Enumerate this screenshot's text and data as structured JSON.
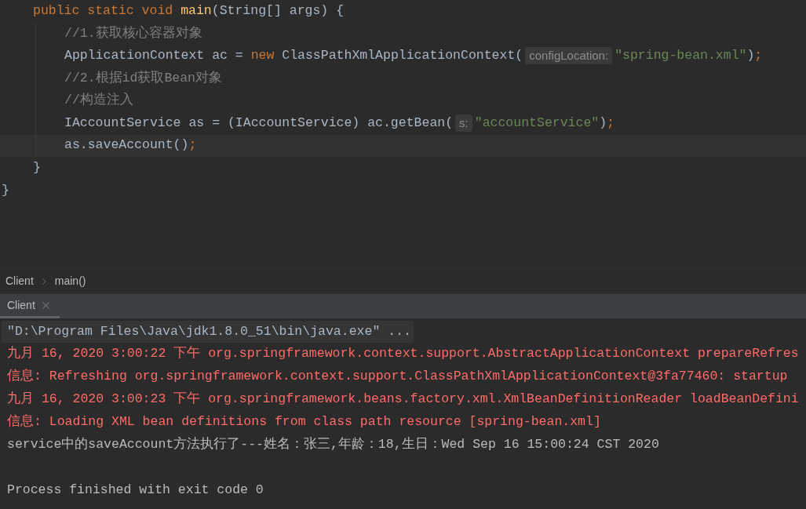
{
  "editor": {
    "class_members": [
      {
        "current": false,
        "tokens": [
          {
            "kind": "keyword",
            "text": "public static void "
          },
          {
            "kind": "method",
            "text": "main"
          },
          {
            "kind": "plain",
            "text": "(String[] args) {"
          }
        ],
        "children": [
          {
            "current": false,
            "tokens": [
              {
                "kind": "comment",
                "text": "//1.获取核心容器对象"
              }
            ]
          },
          {
            "current": false,
            "tokens": [
              {
                "kind": "plain",
                "text": "ApplicationContext ac = "
              },
              {
                "kind": "keyword",
                "text": "new"
              },
              {
                "kind": "plain",
                "text": " ClassPathXmlApplicationContext("
              },
              {
                "kind": "hint",
                "text": "configLocation:"
              },
              {
                "kind": "string",
                "text": "\"spring-bean.xml\""
              },
              {
                "kind": "plain",
                "text": ")"
              },
              {
                "kind": "keyword",
                "text": ";"
              }
            ]
          },
          {
            "current": false,
            "tokens": [
              {
                "kind": "comment",
                "text": "//2.根据id获取Bean对象"
              }
            ]
          },
          {
            "current": false,
            "tokens": [
              {
                "kind": "comment",
                "text": "//构造注入"
              }
            ]
          },
          {
            "current": false,
            "tokens": [
              {
                "kind": "plain",
                "text": "IAccountService as = (IAccountService) ac.getBean("
              },
              {
                "kind": "hint",
                "text": "s:"
              },
              {
                "kind": "string",
                "text": "\"accountService\""
              },
              {
                "kind": "plain",
                "text": ")"
              },
              {
                "kind": "keyword",
                "text": ";"
              }
            ]
          },
          {
            "current": true,
            "tokens": [
              {
                "kind": "plain",
                "text": "as.saveAccount()"
              },
              {
                "kind": "keyword",
                "text": ";"
              }
            ]
          }
        ]
      },
      {
        "current": false,
        "tokens": [
          {
            "kind": "plain",
            "text": "}"
          }
        ]
      }
    ],
    "closing_line": {
      "current": false,
      "tokens": [
        {
          "kind": "plain",
          "text": "}"
        }
      ]
    }
  },
  "breadcrumbs": [
    {
      "label": "Client"
    },
    {
      "label": "main()"
    }
  ],
  "run_tabs": [
    {
      "label": "Client",
      "selected": true
    }
  ],
  "console": {
    "lines": [
      {
        "kind": "command",
        "text": "\"D:\\Program Files\\Java\\jdk1.8.0_51\\bin\\java.exe\" ..."
      },
      {
        "kind": "stderr",
        "text": "九月 16, 2020 3:00:22 下午 org.springframework.context.support.AbstractApplicationContext prepareRefres"
      },
      {
        "kind": "stderr",
        "text": "信息: Refreshing org.springframework.context.support.ClassPathXmlApplicationContext@3fa77460: startup"
      },
      {
        "kind": "stderr",
        "text": "九月 16, 2020 3:00:23 下午 org.springframework.beans.factory.xml.XmlBeanDefinitionReader loadBeanDefini"
      },
      {
        "kind": "stderr",
        "text": "信息: Loading XML bean definitions from class path resource [spring-bean.xml]"
      },
      {
        "kind": "stdout",
        "text": "service中的saveAccount方法执行了---姓名：张三,年龄：18,生日：Wed Sep 16 15:00:24 CST 2020"
      },
      {
        "kind": "exit",
        "text": "Process finished with exit code 0"
      }
    ]
  }
}
